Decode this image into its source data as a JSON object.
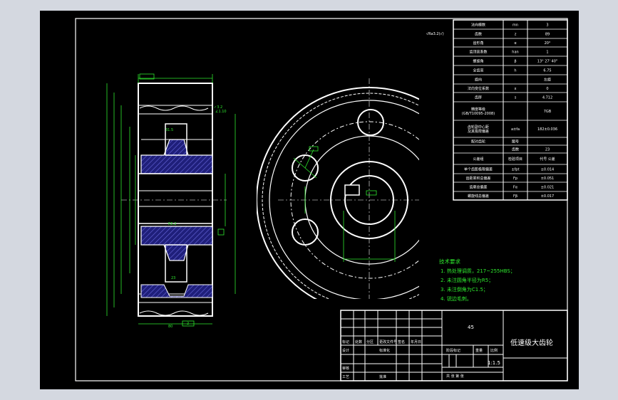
{
  "colors": {
    "background_outer": "#d4d8e0",
    "drawing_area": "#000000",
    "line": "#ffffff",
    "dimension": "#2ee82e",
    "hatch": "#3a3aa0",
    "hub_region": "#1f1f7a"
  },
  "roughness_note": "√Ra3.2(√)",
  "tech_requirements": {
    "title": "技术要求",
    "items": [
      "1. 热处理调质，217~255HBS；",
      "2. 未注圆角半径为R5；",
      "3. 未注倒角为C1.5；",
      "4. 锐边毛刺。"
    ]
  },
  "param_table": {
    "rows": [
      {
        "name": "法向模数",
        "sym": "mn",
        "val": "3"
      },
      {
        "name": "齿数",
        "sym": "z",
        "val": "89"
      },
      {
        "name": "齿形角",
        "sym": "α",
        "val": "20°"
      },
      {
        "name": "齿顶高系数",
        "sym": "han",
        "val": "1"
      },
      {
        "name": "螺旋角",
        "sym": "β",
        "val": "13° 27' 40\""
      },
      {
        "name": "全齿高",
        "sym": "h",
        "val": "6.75"
      },
      {
        "name": "旋向",
        "sym": "",
        "val": "左旋"
      },
      {
        "name": "法向变位系数",
        "sym": "x",
        "val": "0"
      },
      {
        "name": "齿厚",
        "sym": "s",
        "val": "4.712"
      },
      {
        "name": "精度等级\n(GB/T10095-2008)",
        "sym": "",
        "val": "7GB"
      },
      {
        "name": "齿轮副中心距\n及其极限偏差",
        "sym": "a±fa",
        "val": "182±0.036"
      },
      {
        "name": "配对齿轮",
        "sym": "图号",
        "val": ""
      },
      {
        "name": "",
        "sym": "齿数",
        "val": "23"
      },
      {
        "name": "公差组",
        "sym": "检验项目",
        "val": "代号  公差"
      },
      {
        "name": "单个齿距极限偏差",
        "sym": "±fpt",
        "val": "±0.014"
      },
      {
        "name": "齿距累积总偏差",
        "sym": "Fp",
        "val": "±0.051"
      },
      {
        "name": "齿廓总偏差",
        "sym": "Fα",
        "val": "±0.021"
      },
      {
        "name": "螺旋线总偏差",
        "sym": "Fβ",
        "val": "±0.017"
      }
    ]
  },
  "title_block": {
    "drawing_name": "低速级大齿轮",
    "material": "45",
    "scale": "1:1.5",
    "labels": {
      "mark": "标记",
      "count": "处数",
      "zone": "分区",
      "change_no": "更改文件号",
      "sign": "签名",
      "date": "年月日",
      "design": "设计",
      "standardize": "标准化",
      "stage_mark": "阶段标记",
      "weight": "重量",
      "scale_label": "比例",
      "review": "审核",
      "process": "工艺",
      "approve": "批准",
      "sheet": "共 张 第 张"
    }
  }
}
